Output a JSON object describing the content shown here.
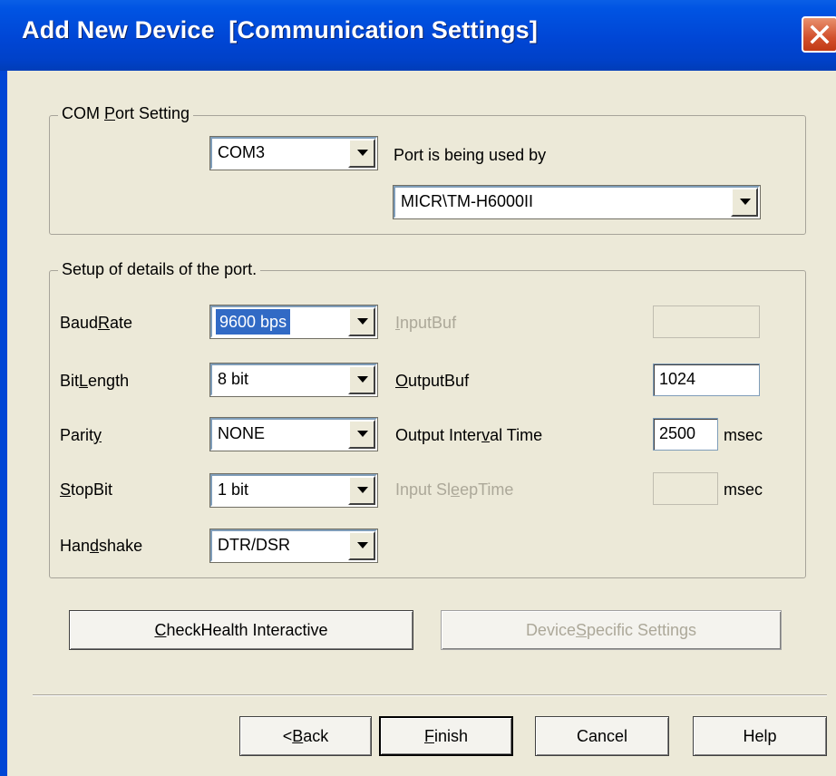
{
  "window": {
    "title": "Add New Device  [Communication Settings]"
  },
  "com_port_group": {
    "legend_pre": "COM ",
    "legend_u": "P",
    "legend_post": "ort Setting",
    "port_value": "COM3",
    "used_by_label": "Port is being used by",
    "used_by_value": "MICR\\TM-H6000II"
  },
  "details_group": {
    "legend": "Setup of details of the port.",
    "baudrate": {
      "pre": "Baud",
      "u": "R",
      "post": "ate",
      "value": "9600 bps"
    },
    "bitlength": {
      "pre": "Bit",
      "u": "L",
      "post": "ength",
      "value": "8 bit"
    },
    "parity": {
      "pre": "Parit",
      "u": "y",
      "post": "",
      "value": "NONE"
    },
    "stopbit": {
      "pre": "",
      "u": "S",
      "post": "topBit",
      "value": "1 bit"
    },
    "handshake": {
      "pre": "Han",
      "u": "d",
      "post": "shake",
      "value": "DTR/DSR"
    },
    "inputbuf": {
      "pre": "",
      "u": "I",
      "post": "nputBuf",
      "value": ""
    },
    "outputbuf": {
      "pre": "",
      "u": "O",
      "post": "utputBuf",
      "value": "1024"
    },
    "output_interval": {
      "pre": "Output Inter",
      "u": "v",
      "post": "al Time",
      "value": "2500",
      "unit": "msec"
    },
    "input_sleep": {
      "pre": "Input Sl",
      "u": "e",
      "post": "epTime",
      "value": "",
      "unit": "msec"
    }
  },
  "buttons": {
    "checkhealth": {
      "u": "C",
      "post": "heckHealth Interactive"
    },
    "device_specific": {
      "pre": "Device ",
      "u": "S",
      "post": "pecific Settings"
    },
    "back": {
      "pre": "< ",
      "u": "B",
      "post": "ack"
    },
    "finish": {
      "u": "F",
      "post": "inish"
    },
    "cancel": "Cancel",
    "help": "Help"
  }
}
